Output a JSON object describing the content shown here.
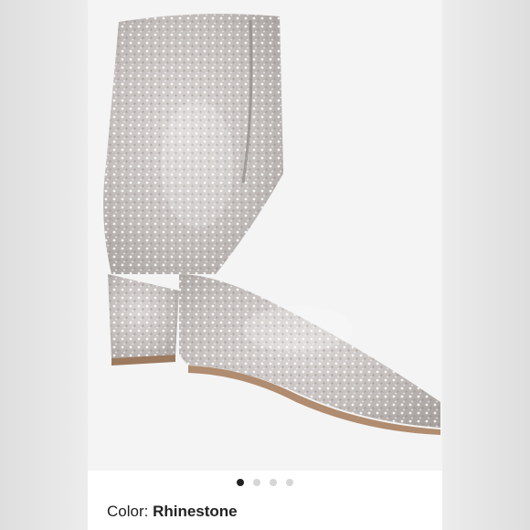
{
  "product": {
    "color_label": "Color:",
    "color_value": "Rhinestone",
    "image_subject": "rhinestone-ankle-boot",
    "carousel": {
      "total": 4,
      "active_index": 0
    }
  },
  "colors": {
    "boot_base": "#c9c4c1",
    "sparkle": "#ffffff",
    "active_dot": "#222222",
    "inactive_dot": "#d6d6d6"
  }
}
